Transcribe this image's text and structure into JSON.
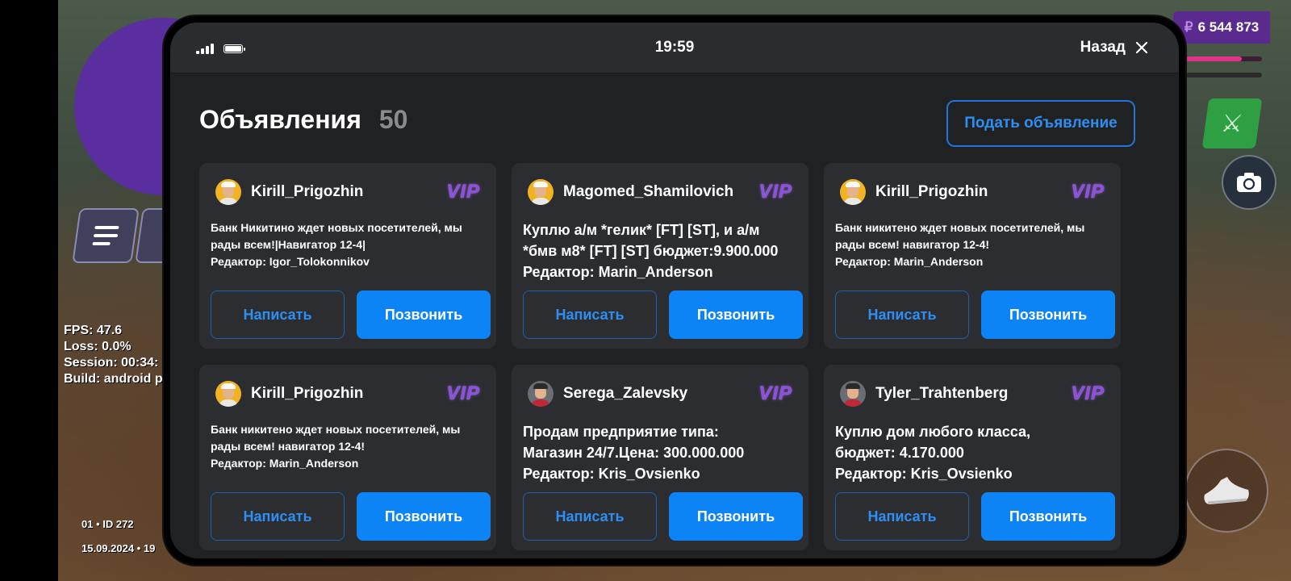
{
  "hud": {
    "money_symbol": "₽",
    "money": "6 544 873",
    "health_fraction": 0.73,
    "debug": {
      "fps": "FPS: 47.6",
      "loss": "Loss: 0.0%",
      "session": "Session: 00:34:",
      "build": "Build: android p"
    },
    "server_id": "01 • ID 272",
    "date": "15.09.2024 • 19"
  },
  "phone": {
    "status_bar": {
      "time": "19:59",
      "back_label": "Назад"
    },
    "header": {
      "title": "Объявления",
      "count": "50",
      "post_button": "Подать объявление"
    },
    "ads": [
      {
        "author": "Kirill_Prigozhin",
        "badge": "VIP",
        "avatar": "gold",
        "text": "Банк Никитино ждет новых посетителей, мы\nрады всем!|Навигатор 12-4|\nРедактор: Igor_Tolokonnikov",
        "size": "small",
        "write": "Написать",
        "call": "Позвонить"
      },
      {
        "author": "Magomed_Shamilovich",
        "badge": "VIP",
        "avatar": "gold",
        "text": "Куплю а/м *гелик* [FT] [ST], и а/м\n*бмв м8* [FT] [ST] бюджет:9.900.000\nРедактор: Marin_Anderson",
        "size": "large",
        "write": "Написать",
        "call": "Позвонить"
      },
      {
        "author": "Kirill_Prigozhin",
        "badge": "VIP",
        "avatar": "gold",
        "text": "Банк никитено ждет новых посетителей, мы\nрады всем! навигатор 12-4!\nРедактор: Marin_Anderson",
        "size": "small",
        "write": "Написать",
        "call": "Позвонить"
      },
      {
        "author": "Kirill_Prigozhin",
        "badge": "VIP",
        "avatar": "gold",
        "text": "Банк никитено ждет новых посетителей, мы\nрады всем! навигатор 12-4!\nРедактор: Marin_Anderson",
        "size": "small",
        "write": "Написать",
        "call": "Позвонить"
      },
      {
        "author": "Serega_Zalevsky",
        "badge": "VIP",
        "avatar": "gray",
        "text": "Продам предприятие типа:\nМагазин 24/7.Цена: 300.000.000\nРедактор: Kris_Ovsienko",
        "size": "large",
        "write": "Написать",
        "call": "Позвонить"
      },
      {
        "author": "Tyler_Trahtenberg",
        "badge": "VIP",
        "avatar": "gray",
        "text": "Куплю дом любого класса,\nбюджет: 4.170.000\nРедактор: Kris_Ovsienko",
        "size": "large",
        "write": "Написать",
        "call": "Позвонить"
      }
    ]
  }
}
